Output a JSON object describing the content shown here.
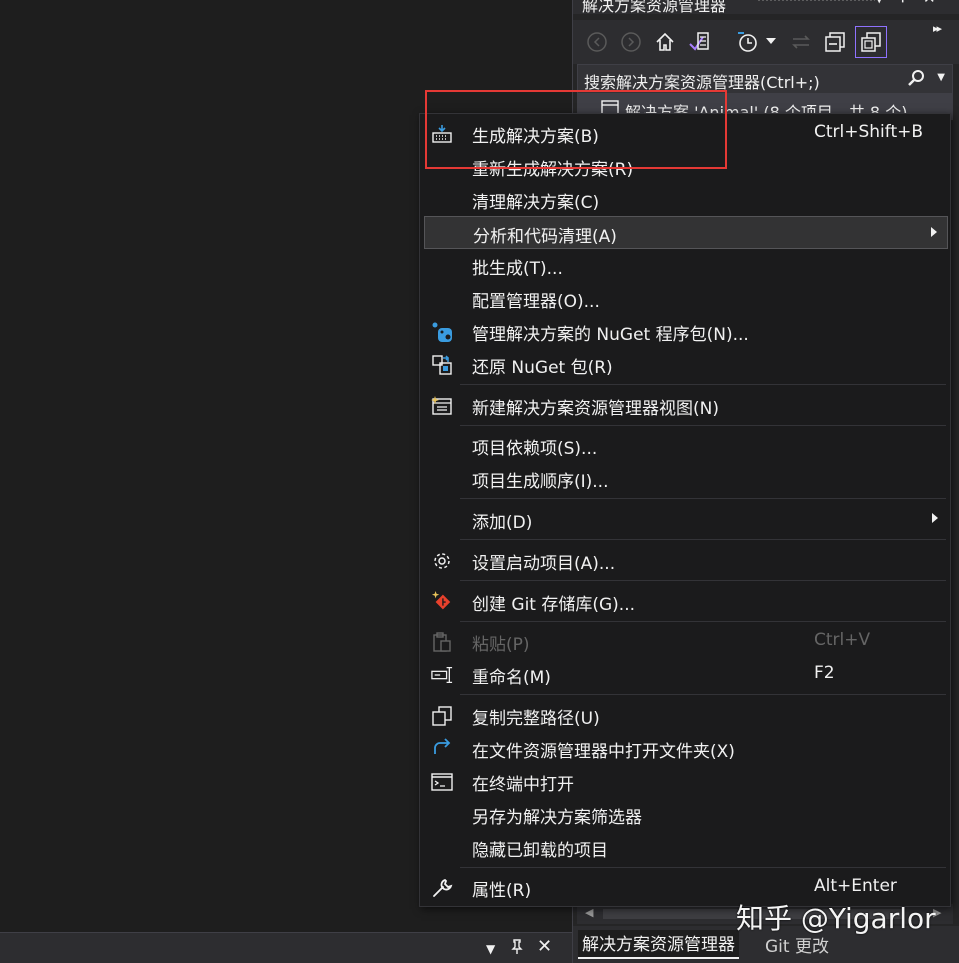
{
  "solution_explorer": {
    "title": "解决方案资源管理器",
    "search_placeholder": "搜索解决方案资源管理器(Ctrl+;)",
    "solution_node_label": "解决方案 'Animal' (8 个项目，共 8 个)",
    "bottom_tabs": [
      {
        "label": "解决方案资源管理器",
        "active": true
      },
      {
        "label": "Git 更改",
        "active": false
      }
    ]
  },
  "context_menu": {
    "items": [
      {
        "icon": "build-icon",
        "label": "生成解决方案(B)",
        "shortcut": "Ctrl+Shift+B"
      },
      {
        "icon": "",
        "label": "重新生成解决方案(R)",
        "shortcut": ""
      },
      {
        "icon": "",
        "label": "清理解决方案(C)",
        "shortcut": ""
      },
      {
        "icon": "",
        "label": "分析和代码清理(A)",
        "shortcut": "",
        "submenu": true,
        "hover": true
      },
      {
        "icon": "",
        "label": "批生成(T)...",
        "shortcut": ""
      },
      {
        "icon": "",
        "label": "配置管理器(O)...",
        "shortcut": ""
      },
      {
        "icon": "nuget-icon",
        "label": "管理解决方案的 NuGet 程序包(N)...",
        "shortcut": ""
      },
      {
        "icon": "restore-package-icon",
        "label": "还原 NuGet 包(R)",
        "shortcut": ""
      },
      {
        "icon": "new-view-icon",
        "label": "新建解决方案资源管理器视图(N)",
        "shortcut": ""
      },
      {
        "icon": "",
        "label": "项目依赖项(S)...",
        "shortcut": ""
      },
      {
        "icon": "",
        "label": "项目生成顺序(I)...",
        "shortcut": ""
      },
      {
        "icon": "",
        "label": "添加(D)",
        "shortcut": "",
        "submenu": true
      },
      {
        "icon": "gear-icon",
        "label": "设置启动项目(A)...",
        "shortcut": ""
      },
      {
        "icon": "git-repo-icon",
        "label": "创建 Git 存储库(G)...",
        "shortcut": ""
      },
      {
        "icon": "paste-icon",
        "label": "粘贴(P)",
        "shortcut": "Ctrl+V",
        "disabled": true
      },
      {
        "icon": "rename-icon",
        "label": "重命名(M)",
        "shortcut": "F2"
      },
      {
        "icon": "copy-path-icon",
        "label": "复制完整路径(U)",
        "shortcut": ""
      },
      {
        "icon": "open-folder-icon",
        "label": "在文件资源管理器中打开文件夹(X)",
        "shortcut": ""
      },
      {
        "icon": "terminal-icon",
        "label": "在终端中打开",
        "shortcut": ""
      },
      {
        "icon": "",
        "label": "另存为解决方案筛选器",
        "shortcut": ""
      },
      {
        "icon": "",
        "label": "隐藏已卸载的项目",
        "shortcut": ""
      },
      {
        "icon": "wrench-icon",
        "label": "属性(R)",
        "shortcut": "Alt+Enter"
      }
    ]
  },
  "colors": {
    "annotation_box": "#e53935",
    "accent": "#8f72ff",
    "git_red": "#e8412c",
    "icon_blue": "#3a9ce0"
  },
  "watermark": "知乎 @Yigarlor"
}
